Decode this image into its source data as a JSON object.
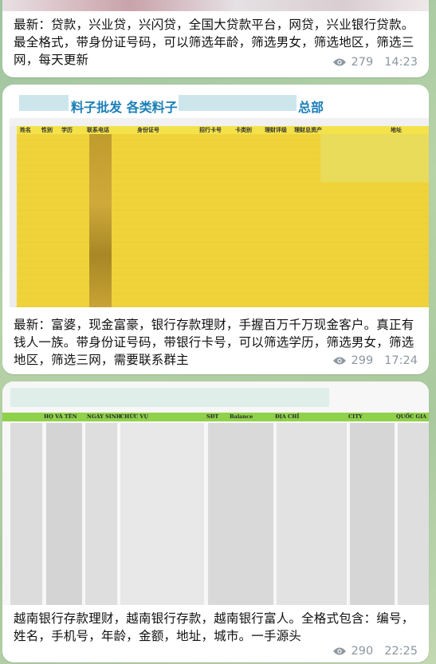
{
  "messages": [
    {
      "caption": "最新：贷款，兴业贷，兴闪贷，全国大贷款平台，网贷，兴业银行贷款。最全格式，带身份证号码，可以筛选年龄，筛选男女，筛选地区，筛选三网，每天更新",
      "views": "279",
      "time": "14:23"
    },
    {
      "image": {
        "title": "料子批发 各类料子",
        "title_suffix": "总部",
        "columns": [
          "姓名",
          "性别",
          "学历",
          "联系电话",
          "身份证号",
          "招行卡号",
          "卡类别",
          "理财评级",
          "理财总资产",
          "地址"
        ]
      },
      "caption": "最新：富婆，现金富豪，银行存款理财，手握百万千万现金客户。真正有钱人一族。带身份证号码，带银行卡号，可以筛选学历，筛选男女，筛选地区，筛选三网，需要联系群主",
      "views": "299",
      "time": "17:24"
    },
    {
      "image": {
        "columns": [
          "HỌ VÀ TÊN",
          "NGÀY SINH",
          "CHỨC VỤ",
          "SĐT",
          "Balance",
          "ĐỊA CHỈ",
          "CITY",
          "QUỐC GIA"
        ]
      },
      "caption": "越南银行存款理财，越南银行存款，越南银行富人。全格式包含：编号，姓名，手机号，年龄，金额，地址，城市。一手源头",
      "views": "290",
      "time": "22:25"
    }
  ],
  "colors": {
    "background": "#a9c99e",
    "bubble": "#ffffff",
    "meta": "#8c97a0",
    "sheet_header": "#f3e24a",
    "vn_header": "#8fd14a",
    "title_blue": "#1b7fb8"
  },
  "icons": {
    "views": "eye-icon"
  }
}
